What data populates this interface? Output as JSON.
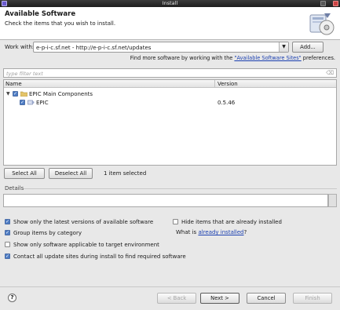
{
  "window": {
    "title": "Install"
  },
  "header": {
    "title": "Available Software",
    "description": "Check the items that you wish to install."
  },
  "work_with": {
    "label": "Work with:",
    "value": "e-p-i-c.sf.net - http://e-p-i-c.sf.net/updates",
    "add_button": "Add...",
    "hint_prefix": "Find more software by working with the ",
    "hint_link": "\"Available Software Sites\"",
    "hint_suffix": " preferences."
  },
  "filter": {
    "placeholder": "type filter text"
  },
  "table": {
    "columns": [
      "Name",
      "Version"
    ],
    "rows": [
      {
        "name": "EPIC Main Components",
        "version": "",
        "checked": true,
        "expanded": true
      },
      {
        "name": "EPIC",
        "version": "0.5.46",
        "checked": true
      }
    ]
  },
  "selection": {
    "select_all": "Select All",
    "deselect_all": "Deselect All",
    "info": "1 item selected"
  },
  "details": {
    "label": "Details"
  },
  "options": {
    "latest_only": "Show only the latest versions of available software",
    "group_by_category": "Group items by category",
    "target_env": "Show only software applicable to target environment",
    "contact_all": "Contact all update sites during install to find required software",
    "hide_installed": "Hide items that are already installed",
    "latest_only_checked": true,
    "group_by_category_checked": true,
    "target_env_checked": false,
    "contact_all_checked": true,
    "hide_installed_checked": false
  },
  "what_is": {
    "prefix": "What is ",
    "link": "already installed",
    "suffix": "?"
  },
  "footer": {
    "help": "?",
    "back": "< Back",
    "next": "Next >",
    "cancel": "Cancel",
    "finish": "Finish"
  }
}
